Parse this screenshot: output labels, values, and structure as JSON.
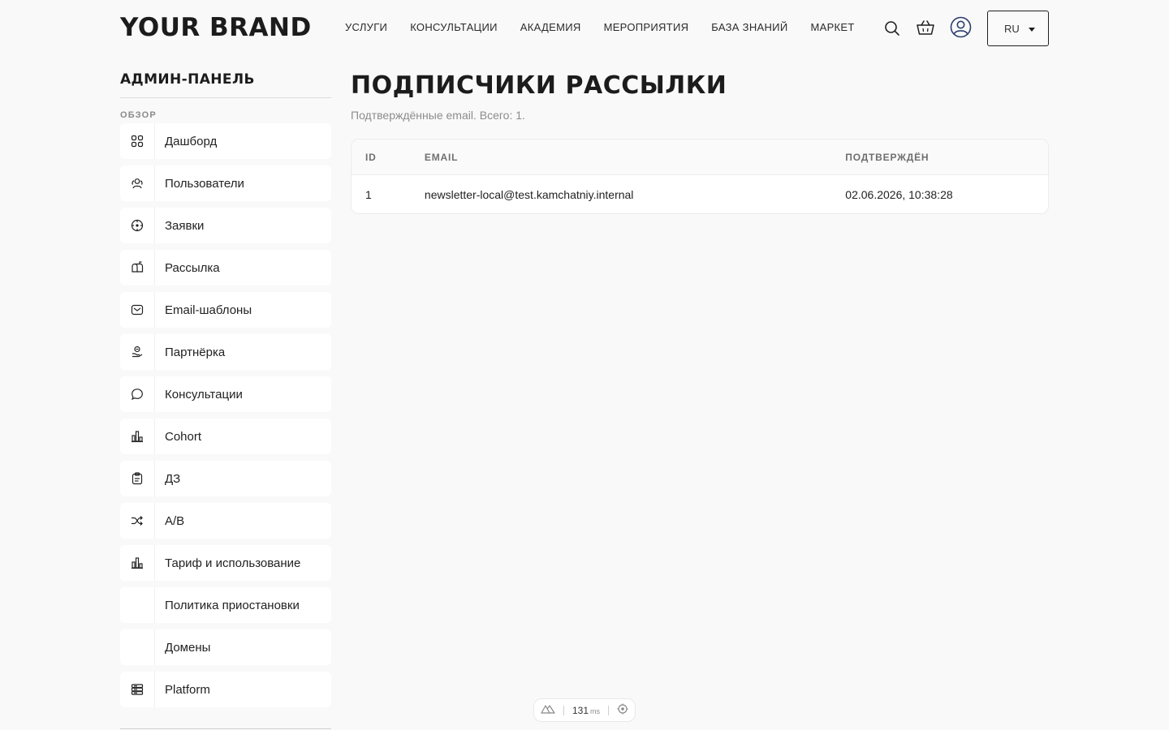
{
  "header": {
    "brand": "YOUR BRAND",
    "nav": [
      "УСЛУГИ",
      "КОНСУЛЬТАЦИИ",
      "АКАДЕМИЯ",
      "МЕРОПРИЯТИЯ",
      "БАЗА ЗНАНИЙ",
      "МАРКЕТ"
    ],
    "icons": [
      "search-icon",
      "cart-icon",
      "user-icon"
    ],
    "language": "RU"
  },
  "sidebar": {
    "title": "АДМИН-ПАНЕЛЬ",
    "section": "ОБЗОР",
    "items": [
      {
        "label": "Дашборд",
        "icon": "grid-icon"
      },
      {
        "label": "Пользователи",
        "icon": "users-icon"
      },
      {
        "label": "Заявки",
        "icon": "target-icon"
      },
      {
        "label": "Рассылка",
        "icon": "mailbox-icon"
      },
      {
        "label": "Email-шаблоны",
        "icon": "envelope-icon"
      },
      {
        "label": "Партнёрка",
        "icon": "partner-icon"
      },
      {
        "label": "Консультации",
        "icon": "chat-bubble-icon"
      },
      {
        "label": "Cohort",
        "icon": "bar-chart-icon"
      },
      {
        "label": "ДЗ",
        "icon": "clipboard-icon"
      },
      {
        "label": "A/B",
        "icon": "shuffle-icon"
      },
      {
        "label": "Тариф и использование",
        "icon": "bar-chart-icon"
      },
      {
        "label": "Политика приостановки",
        "icon": ""
      },
      {
        "label": "Домены",
        "icon": ""
      },
      {
        "label": "Platform",
        "icon": "server-icon"
      }
    ]
  },
  "main": {
    "title": "ПОДПИСЧИКИ РАССЫЛКИ",
    "subtitle": "Подтверждённые email. Всего: 1.",
    "table": {
      "columns": [
        "ID",
        "EMAIL",
        "ПОДТВЕРЖДЁН"
      ],
      "rows": [
        [
          "1",
          "newsletter-local@test.kamchatniy.internal",
          "02.06.2026, 10:38:28"
        ]
      ]
    }
  },
  "perf": {
    "value": "131",
    "unit": "ms"
  }
}
